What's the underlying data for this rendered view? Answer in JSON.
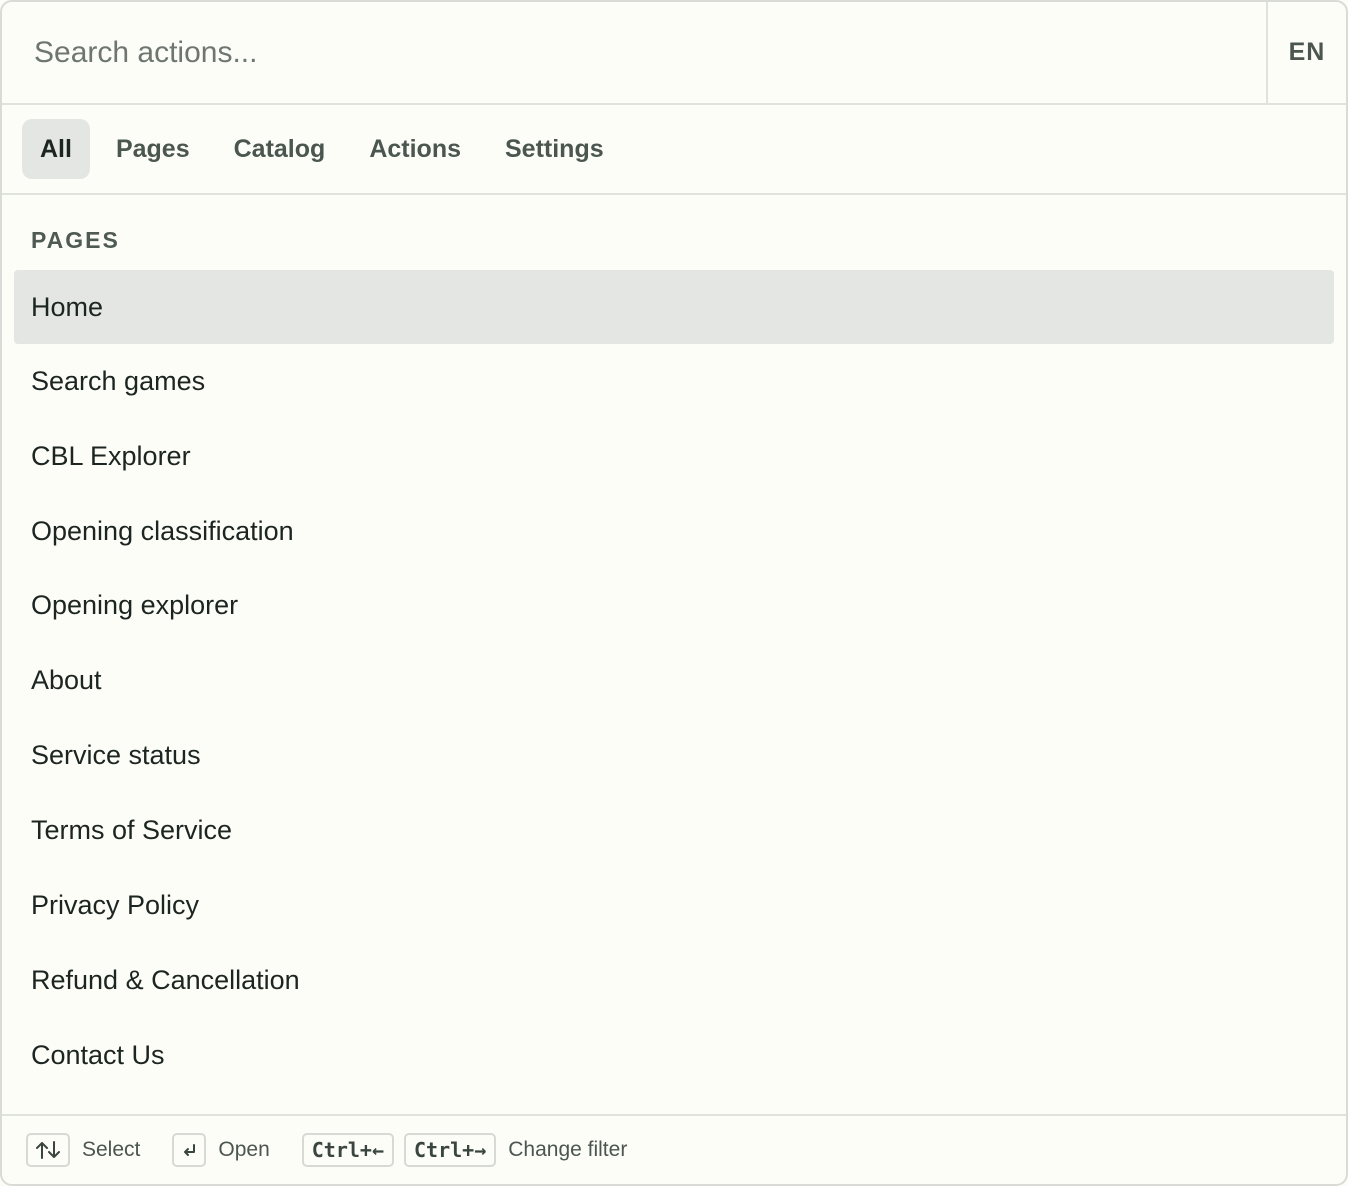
{
  "search": {
    "placeholder": "Search actions..."
  },
  "language": {
    "label": "EN"
  },
  "tabs": [
    {
      "label": "All",
      "active": true
    },
    {
      "label": "Pages"
    },
    {
      "label": "Catalog"
    },
    {
      "label": "Actions"
    },
    {
      "label": "Settings"
    }
  ],
  "section": {
    "title": "PAGES"
  },
  "items": [
    {
      "label": "Home",
      "selected": true
    },
    {
      "label": "Search games"
    },
    {
      "label": "CBL Explorer"
    },
    {
      "label": "Opening classification"
    },
    {
      "label": "Opening explorer"
    },
    {
      "label": "About"
    },
    {
      "label": "Service status"
    },
    {
      "label": "Terms of Service"
    },
    {
      "label": "Privacy Policy"
    },
    {
      "label": "Refund & Cancellation"
    },
    {
      "label": "Contact Us"
    }
  ],
  "footer": {
    "select_icon": "up-down-arrows-icon",
    "select_label": "Select",
    "open_icon": "enter-icon",
    "open_label": "Open",
    "prev_key": "Ctrl+←",
    "next_key": "Ctrl+→",
    "filter_label": "Change filter"
  }
}
